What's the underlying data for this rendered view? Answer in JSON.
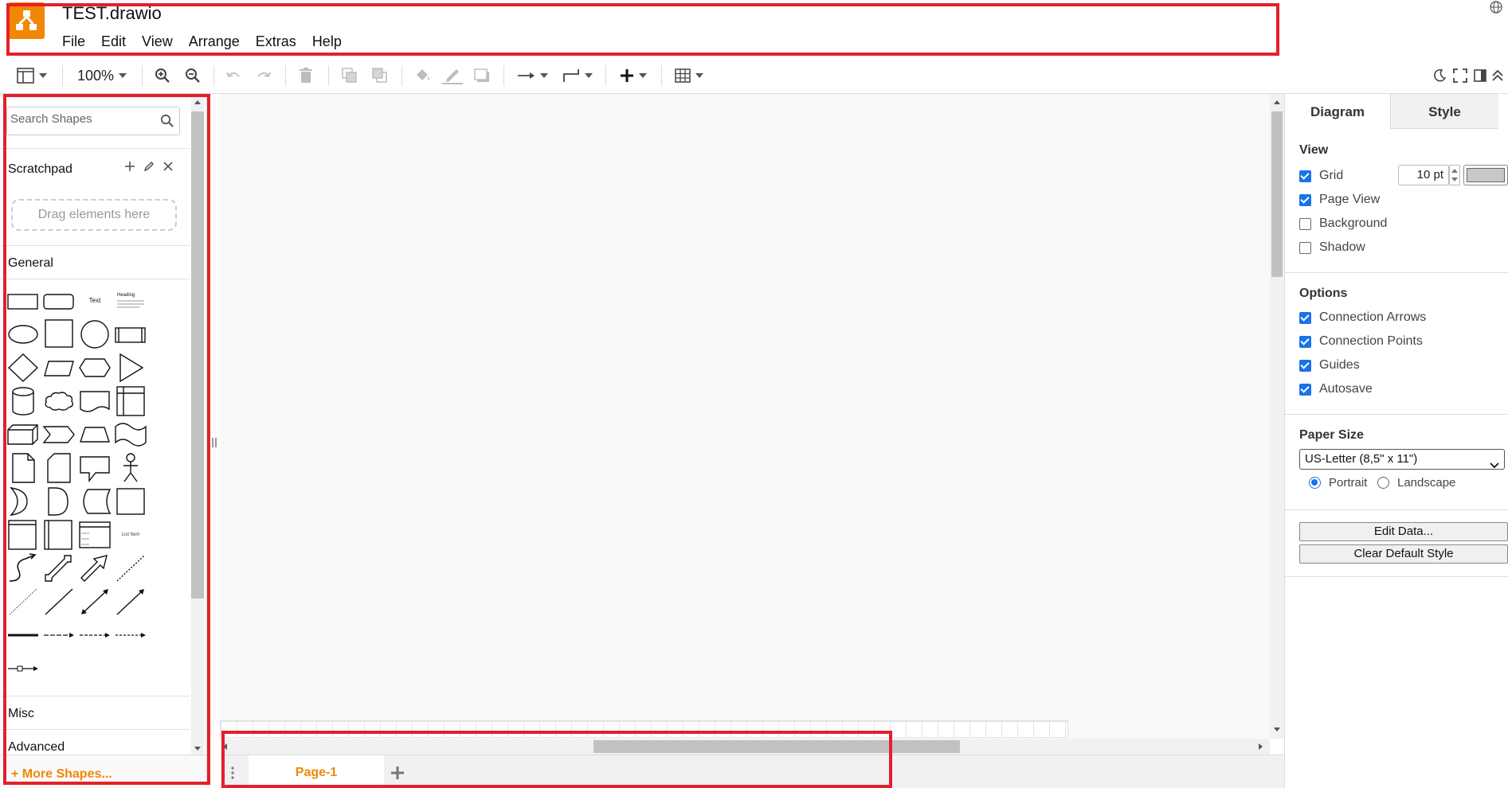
{
  "app": {
    "title": "TEST.drawio",
    "brand_color": "#f08705",
    "menu": [
      "File",
      "Edit",
      "View",
      "Arrange",
      "Extras",
      "Help"
    ]
  },
  "toolbar": {
    "zoom": "100%"
  },
  "sidebar": {
    "search_placeholder": "Search Shapes",
    "scratchpad_title": "Scratchpad",
    "drag_hint": "Drag elements here",
    "general_title": "General",
    "misc_title": "Misc",
    "advanced_title": "Advanced",
    "more_shapes": "+ More Shapes...",
    "shape_labels": {
      "text": "Text",
      "heading": "Heading",
      "list_item": "List Item"
    }
  },
  "pages": {
    "tabs": [
      "Page-1"
    ],
    "active": "Page-1"
  },
  "format_panel": {
    "tabs": [
      "Diagram",
      "Style"
    ],
    "view": {
      "title": "View",
      "grid_label": "Grid",
      "grid_checked": true,
      "grid_size": "10 pt",
      "grid_color": "#c8c8c8",
      "page_view_label": "Page View",
      "page_view_checked": true,
      "background_label": "Background",
      "background_checked": false,
      "shadow_label": "Shadow",
      "shadow_checked": false
    },
    "options": {
      "title": "Options",
      "items": [
        {
          "label": "Connection Arrows",
          "checked": true
        },
        {
          "label": "Connection Points",
          "checked": true
        },
        {
          "label": "Guides",
          "checked": true
        },
        {
          "label": "Autosave",
          "checked": true
        }
      ]
    },
    "paper": {
      "title": "Paper Size",
      "size": "US-Letter (8,5\" x 11\")",
      "portrait_label": "Portrait",
      "landscape_label": "Landscape",
      "orientation": "portrait"
    },
    "buttons": {
      "edit_data": "Edit Data...",
      "clear_style": "Clear Default Style"
    }
  }
}
